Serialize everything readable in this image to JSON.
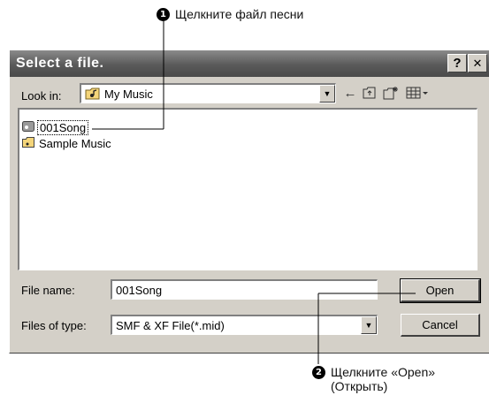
{
  "callouts": {
    "step1": {
      "number": "1",
      "text": "Щелкните файл песни"
    },
    "step2": {
      "number": "2",
      "text_line1": "Щелкните «Open»",
      "text_line2": "(Открыть)"
    }
  },
  "dialog": {
    "title": "Select a file.",
    "help_button": "?",
    "close_button": "✕",
    "look_in_label": "Look in:",
    "look_in_value": "My Music",
    "files": [
      {
        "name": "001Song",
        "icon": "song-file-icon",
        "selected": true
      },
      {
        "name": "Sample Music",
        "icon": "folder-icon",
        "selected": false
      }
    ],
    "file_name_label": "File name:",
    "file_name_value": "001Song",
    "files_of_type_label": "Files of type:",
    "files_of_type_value": "SMF & XF File(*.mid)",
    "open_button": "Open",
    "cancel_button": "Cancel"
  }
}
